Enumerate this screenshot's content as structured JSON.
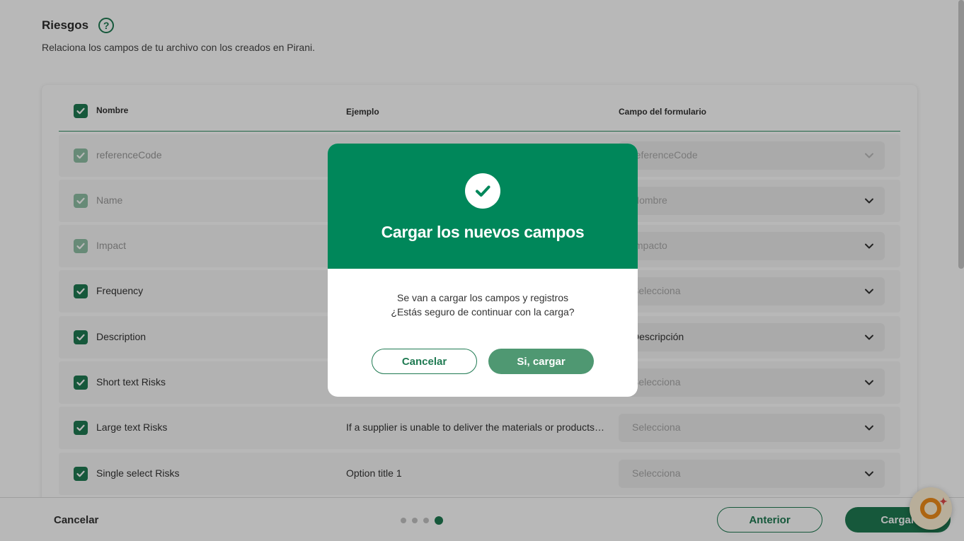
{
  "header": {
    "title": "Riesgos",
    "help_icon": "?",
    "subtitle": "Relaciona los campos de tu archivo con los creados en Pirani."
  },
  "table": {
    "columns": {
      "nombre": "Nombre",
      "ejemplo": "Ejemplo",
      "campo": "Campo del formulario"
    },
    "rows": [
      {
        "name": "referenceCode",
        "example": "",
        "field": "referenceCode",
        "field_placeholder": false,
        "disabled": true
      },
      {
        "name": "Name",
        "example": "",
        "field": "Nombre",
        "field_placeholder": false,
        "disabled": true
      },
      {
        "name": "Impact",
        "example": "",
        "field": "Impacto",
        "field_placeholder": false,
        "disabled": true
      },
      {
        "name": "Frequency",
        "example": "",
        "field": "Selecciona",
        "field_placeholder": true,
        "disabled": false
      },
      {
        "name": "Description",
        "example": "",
        "field": "Descripción",
        "field_placeholder": false,
        "disabled": false
      },
      {
        "name": "Short text Risks",
        "example": "",
        "field": "Selecciona",
        "field_placeholder": true,
        "disabled": false
      },
      {
        "name": "Large text Risks",
        "example": "If a supplier is unable to deliver the materials or products…",
        "field": "Selecciona",
        "field_placeholder": true,
        "disabled": false
      },
      {
        "name": "Single select Risks",
        "example": "Option title 1",
        "field": "Selecciona",
        "field_placeholder": true,
        "disabled": false
      }
    ]
  },
  "footer": {
    "cancel_label": "Cancelar",
    "steps_total": 4,
    "step_active": 4,
    "prev_label": "Anterior",
    "load_label": "Cargar"
  },
  "modal": {
    "title": "Cargar los nuevos campos",
    "body_line1": "Se van a cargar los campos y registros",
    "body_line2": "¿Estás seguro de continuar con la carga?",
    "cancel_label": "Cancelar",
    "confirm_label": "Si, cargar"
  },
  "colors": {
    "primary": "#1f7a52",
    "modal_header": "#00875a",
    "confirm_button": "#4f9872",
    "assistant_ring": "#f08c1a"
  }
}
